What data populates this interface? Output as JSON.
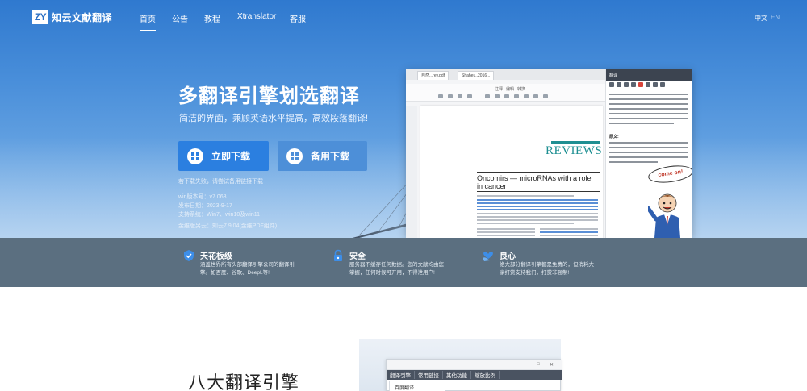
{
  "brand": {
    "logo_mark": "ZY",
    "name": "知云文献翻译"
  },
  "nav": {
    "links": [
      "首页",
      "公告",
      "教程",
      "Xtranslator",
      "客服"
    ],
    "active_index": 0,
    "lang": [
      "中文",
      "EN"
    ]
  },
  "hero": {
    "title": "多翻译引擎划选翻译",
    "subtitle": "简洁的界面，兼顾英语水平提高，高效段落翻译!",
    "primary_button": "立即下载",
    "secondary_button": "备用下载",
    "info": [
      "若下载失败，请尝试备用链接下载",
      "win版本号：v7.068",
      "发布日期：2023-9-17",
      "支持系统：Win7、win10及win11",
      "金维版另云：知云7.9.04(金维PDF组件)"
    ]
  },
  "app_preview": {
    "tabs": [
      "自然...rev.pdf",
      "Shaheu..2016..."
    ],
    "toolbar_tabs": [
      "注释",
      "编辑",
      "转换"
    ],
    "journal_header": "REVIEWS",
    "article_title": "Oncomirs — microRNAs with a role in cancer",
    "right_panel_header": "翻译",
    "right_section_label": "原文:",
    "callout": "come on!"
  },
  "features": [
    {
      "icon": "shield-icon",
      "title": "天花板级",
      "desc": "涵盖世界所有头部翻译引擎公司的翻译引擎。如百度、谷歌、DeepL等!"
    },
    {
      "icon": "lock-icon",
      "title": "安全",
      "desc": "服务器不缓存任何数据。您的文献均由您掌握，任何时候可开用，不得泄用户!"
    },
    {
      "icon": "handshake-icon",
      "title": "良心",
      "desc": "绝大部分翻译引擎都是免费的，但消耗大家打赏支持我们，打赏非强制!"
    }
  ],
  "lower": {
    "title": "八大翻译引擎",
    "menu": [
      "翻译引擎",
      "常用链接",
      "其他功能",
      "缩放比例"
    ],
    "submenu_first": "百度翻译"
  },
  "colors": {
    "hero_top": "#2f79cf",
    "primary_button": "#2b7fe0",
    "feature_bar": "#5b6f80",
    "journal_accent": "#1e8f92"
  }
}
